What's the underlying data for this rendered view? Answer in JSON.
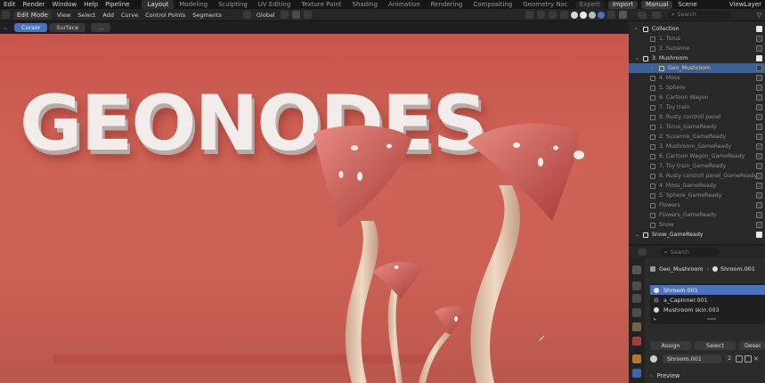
{
  "topmenu": {
    "items": [
      "Edit",
      "Render",
      "Window",
      "Help",
      "Pipeline"
    ],
    "workspaces": [
      "Layout",
      "Modeling",
      "Sculpting",
      "UV Editing",
      "Texture Paint",
      "Shading",
      "Animation",
      "Rendering",
      "Compositing",
      "Geometry Noc"
    ],
    "active_workspace": "Layout",
    "right": {
      "expert": "Expert",
      "import": "Import",
      "manual": "Manual",
      "scene": "Scene",
      "view_layer": "ViewLayer"
    }
  },
  "viewport_header": {
    "mode": "Edit Mode",
    "menus": [
      "View",
      "Select",
      "Add",
      "Curve",
      "Control Points",
      "Segments"
    ],
    "transform_orientation": "Global",
    "tool_tabs": {
      "cursor": "Cursor",
      "surface": "Surface",
      "more": "..."
    }
  },
  "viewport": {
    "headline": "GEONODES"
  },
  "outliner": {
    "search_placeholder": "Search",
    "rows": [
      {
        "label": "Collection",
        "level": 1,
        "checked": true
      },
      {
        "label": "1. Torus",
        "level": 2,
        "checked": false
      },
      {
        "label": "2. Suzanne",
        "level": 2,
        "checked": false
      },
      {
        "label": "3. Mushroom",
        "level": 1,
        "checked": true
      },
      {
        "label": "Geo_Mushroom",
        "level": 3,
        "checked": false,
        "selected": true
      },
      {
        "label": "4. Moss",
        "level": 2,
        "checked": false
      },
      {
        "label": "5. Sphere",
        "level": 2,
        "checked": false
      },
      {
        "label": "6. Cartoon Wagon",
        "level": 2,
        "checked": false
      },
      {
        "label": "7. Toy train",
        "level": 2,
        "checked": false
      },
      {
        "label": "8. Rusty controll panel",
        "level": 2,
        "checked": false
      },
      {
        "label": "1. Torus_GameReady",
        "level": 2,
        "checked": false
      },
      {
        "label": "2. Suzanne_GameReady",
        "level": 2,
        "checked": false
      },
      {
        "label": "3. Mushroom_GameReady",
        "level": 2,
        "checked": false
      },
      {
        "label": "6. Cartoon Wagon_GameReady",
        "level": 2,
        "checked": false
      },
      {
        "label": "7. Toy train_GameReady",
        "level": 2,
        "checked": false
      },
      {
        "label": "8. Rusty controll panel_GameReady",
        "level": 2,
        "checked": false
      },
      {
        "label": "4. Moss_GameReady",
        "level": 2,
        "checked": false
      },
      {
        "label": "5. Sphere_GameReady",
        "level": 2,
        "checked": false
      },
      {
        "label": "Flowers",
        "level": 2,
        "checked": false
      },
      {
        "label": "Flowers_GameReady",
        "level": 2,
        "checked": false
      },
      {
        "label": "Snow",
        "level": 2,
        "checked": false
      },
      {
        "label": "Snow_GameReady",
        "level": 1,
        "checked": true
      }
    ]
  },
  "properties": {
    "search_placeholder": "Search",
    "breadcrumb_object": "Geo_Mushroom",
    "breadcrumb_material": "Shroom.001",
    "materials": [
      {
        "name": "Shroom.001",
        "color": "#e6e6e6",
        "selected": true
      },
      {
        "name": "a_CapInner.001",
        "color": "#5a5a5a",
        "selected": false
      },
      {
        "name": "Mushroom skin.003",
        "color": "#d8d8d8",
        "selected": false
      }
    ],
    "buttons": {
      "assign": "Assign",
      "select": "Select",
      "deselect": "Desel"
    },
    "material_field": "Shroom.001",
    "user_count": "2",
    "preview_label": "Preview"
  }
}
